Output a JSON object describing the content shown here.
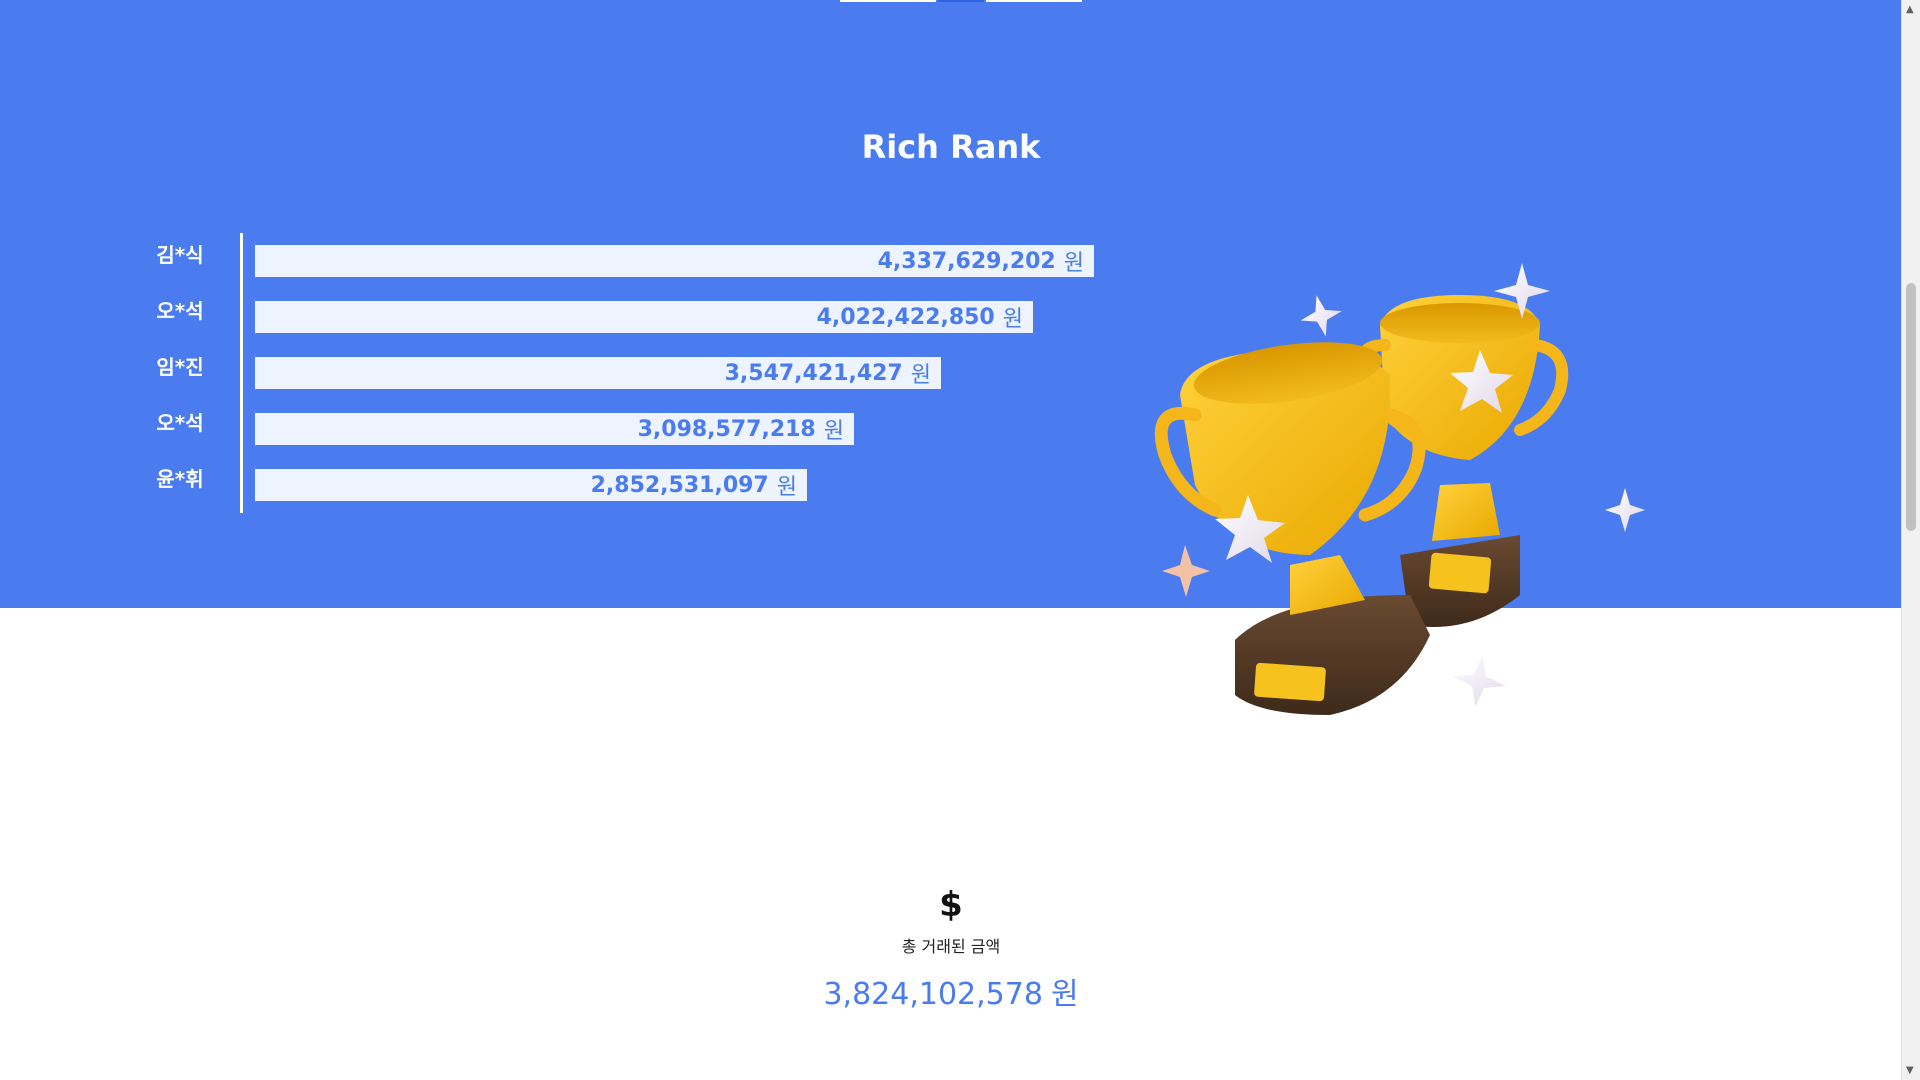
{
  "section_title": "Rich Rank",
  "ranking": [
    {
      "name": "김*식",
      "amount": "4,337,629,202",
      "unit": "원",
      "value": 4337629202
    },
    {
      "name": "오*석",
      "amount": "4,022,422,850",
      "unit": "원",
      "value": 4022422850
    },
    {
      "name": "임*진",
      "amount": "3,547,421,427",
      "unit": "원",
      "value": 3547421427
    },
    {
      "name": "오*석",
      "amount": "3,098,577,218",
      "unit": "원",
      "value": 3098577218
    },
    {
      "name": "윤*휘",
      "amount": "2,852,531,097",
      "unit": "원",
      "value": 2852531097
    }
  ],
  "total": {
    "icon": "dollar-icon",
    "symbol": "$",
    "label": "총 거래된 금액",
    "amount": "3,824,102,578",
    "unit": "원"
  },
  "image": {
    "name": "trophies-illustration"
  },
  "colors": {
    "primary": "#4a7cf0",
    "bar": "#edf3ff",
    "white": "#ffffff"
  }
}
